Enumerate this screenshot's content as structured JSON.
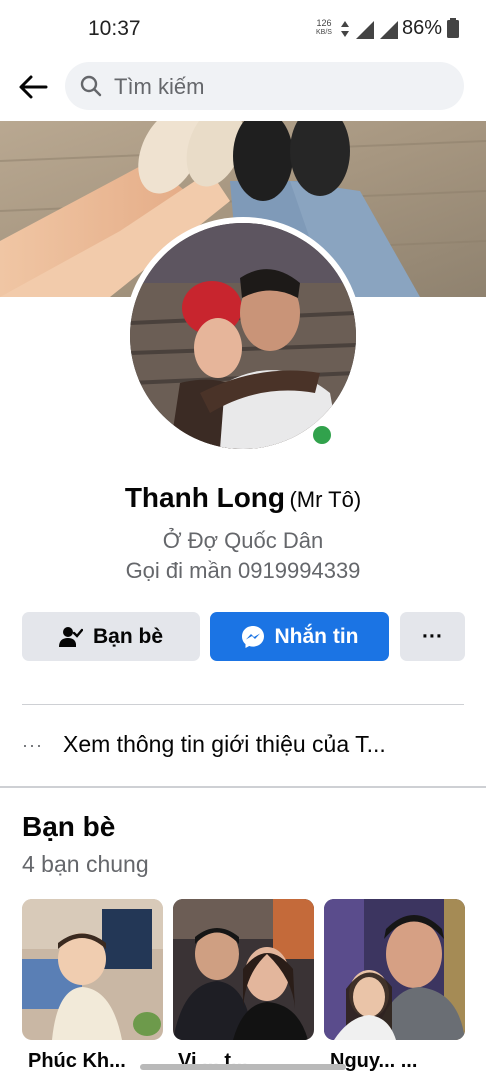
{
  "status_bar": {
    "time": "10:37",
    "net_speed_value": "126",
    "net_speed_unit": "KB/S",
    "network_type": "4G",
    "battery": "86%"
  },
  "search": {
    "placeholder": "Tìm kiếm"
  },
  "profile": {
    "name": "Thanh Long",
    "nickname": "(Mr Tô)",
    "location": "Ở Đợ Quốc Dân",
    "phone_line": "Gọi đi mần 0919994339",
    "online": true
  },
  "actions": {
    "friend_label": "Bạn bè",
    "message_label": "Nhắn tin",
    "more_label": "···"
  },
  "about": {
    "dots": "···",
    "text": "Xem thông tin giới thiệu của T..."
  },
  "friends": {
    "title": "Bạn bè",
    "mutual": "4 bạn chung",
    "cards": [
      {
        "name": "Phúc Kh..."
      },
      {
        "name": "Vi ... t..."
      },
      {
        "name": "Nguy... ..."
      }
    ]
  },
  "colors": {
    "messenger_blue": "#1b74e4",
    "online_green": "#31a24c",
    "secondary_button": "#e4e6eb",
    "secondary_text": "#65676b"
  }
}
